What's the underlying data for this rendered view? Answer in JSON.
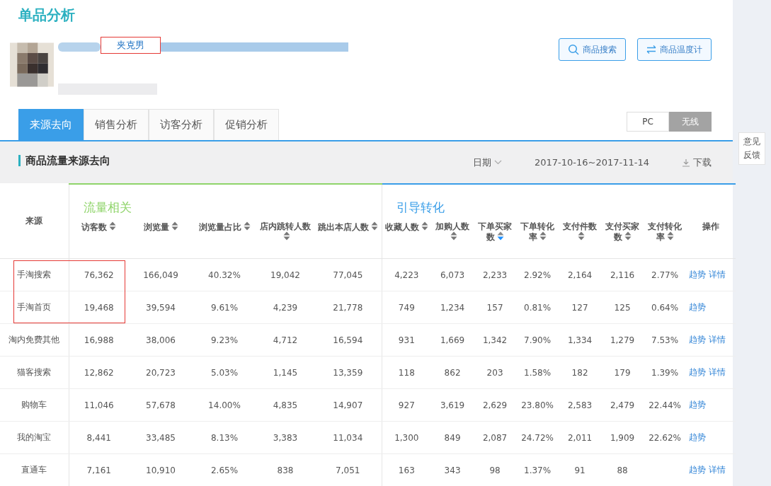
{
  "page_title": "单品分析",
  "product": {
    "title_visible": "夹克男",
    "title_highlighted": true
  },
  "header_buttons": [
    {
      "label": "商品搜索"
    },
    {
      "label": "商品温度计"
    }
  ],
  "tabs": [
    {
      "label": "来源去向",
      "selected": true
    },
    {
      "label": "销售分析",
      "selected": false
    },
    {
      "label": "访客分析",
      "selected": false
    },
    {
      "label": "促销分析",
      "selected": false
    }
  ],
  "device_toggle": [
    {
      "label": "PC",
      "selected": false
    },
    {
      "label": "无线",
      "selected": true
    }
  ],
  "feedback": "意见反馈",
  "section": {
    "title": "商品流量来源去向",
    "date_label": "日期",
    "date_range": "2017-10-16~2017-11-14",
    "download": "下载"
  },
  "table": {
    "source_header": "来源",
    "groups": [
      {
        "label": "流量相关",
        "color": "#8fd46a"
      },
      {
        "label": "引导转化",
        "color": "#3a9ee8"
      }
    ],
    "columns": [
      {
        "label": "访客数",
        "sortable": true,
        "sorted_descending": false
      },
      {
        "label": "浏览量",
        "sortable": true,
        "sorted_descending": false
      },
      {
        "label": "浏览量占比",
        "sortable": true,
        "sorted_descending": false
      },
      {
        "label": "店内跳转人数",
        "sortable": true,
        "sorted_descending": false
      },
      {
        "label": "跳出本店人数",
        "sortable": true,
        "sorted_descending": false
      },
      {
        "label": "收藏人数",
        "sortable": true,
        "sorted_descending": false
      },
      {
        "label": "加购人数",
        "sortable": true,
        "sorted_descending": false
      },
      {
        "label": "下单买家数",
        "sortable": true,
        "sorted_descending": true
      },
      {
        "label": "下单转化率",
        "sortable": true,
        "sorted_descending": false
      },
      {
        "label": "支付件数",
        "sortable": true,
        "sorted_descending": false
      },
      {
        "label": "支付买家数",
        "sortable": true,
        "sorted_descending": false
      },
      {
        "label": "支付转化率",
        "sortable": true,
        "sorted_descending": false
      },
      {
        "label": "操作",
        "sortable": false
      }
    ],
    "rows": [
      {
        "source": "手淘搜索",
        "highlighted": true,
        "values": [
          "76,362",
          "166,049",
          "40.32%",
          "19,042",
          "77,045",
          "4,223",
          "6,073",
          "2,233",
          "2.92%",
          "2,164",
          "2,116",
          "2.77%"
        ],
        "actions": [
          "趋势",
          "详情"
        ]
      },
      {
        "source": "手淘首页",
        "highlighted": true,
        "values": [
          "19,468",
          "39,594",
          "9.61%",
          "4,239",
          "21,778",
          "749",
          "1,234",
          "157",
          "0.81%",
          "127",
          "125",
          "0.64%"
        ],
        "actions": [
          "趋势"
        ]
      },
      {
        "source": "淘内免费其他",
        "highlighted": false,
        "values": [
          "16,988",
          "38,006",
          "9.23%",
          "4,712",
          "16,594",
          "931",
          "1,669",
          "1,342",
          "7.90%",
          "1,334",
          "1,279",
          "7.53%"
        ],
        "actions": [
          "趋势",
          "详情"
        ]
      },
      {
        "source": "猫客搜索",
        "highlighted": false,
        "values": [
          "12,862",
          "20,723",
          "5.03%",
          "1,145",
          "13,359",
          "118",
          "862",
          "203",
          "1.58%",
          "182",
          "179",
          "1.39%"
        ],
        "actions": [
          "趋势",
          "详情"
        ]
      },
      {
        "source": "购物车",
        "highlighted": false,
        "values": [
          "11,046",
          "57,678",
          "14.00%",
          "4,835",
          "14,907",
          "927",
          "3,619",
          "2,629",
          "23.80%",
          "2,583",
          "2,479",
          "22.44%"
        ],
        "actions": [
          "趋势"
        ]
      },
      {
        "source": "我的淘宝",
        "highlighted": false,
        "values": [
          "8,441",
          "33,485",
          "8.13%",
          "3,383",
          "11,034",
          "1,300",
          "849",
          "2,087",
          "24.72%",
          "2,011",
          "1,909",
          "22.62%"
        ],
        "actions": [
          "趋势"
        ]
      },
      {
        "source": "直通车",
        "highlighted": false,
        "values": [
          "7,161",
          "10,910",
          "2.65%",
          "838",
          "7,051",
          "163",
          "343",
          "98",
          "1.37%",
          "91",
          "88"
        ],
        "actions": [
          "趋势",
          "详情"
        ]
      }
    ]
  }
}
